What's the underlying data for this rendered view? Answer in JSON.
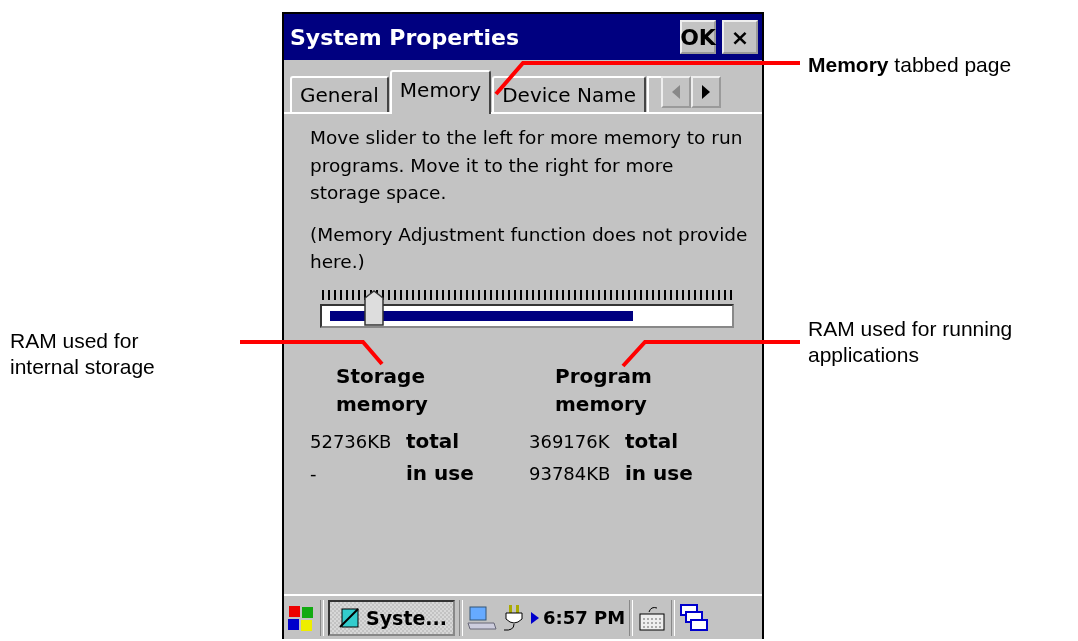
{
  "window": {
    "title": "System Properties",
    "buttons": [
      "OK",
      "×"
    ]
  },
  "tabs": [
    {
      "label": "General",
      "selected": false
    },
    {
      "label": "Memory",
      "selected": true
    },
    {
      "label": "Device Name",
      "selected": false
    }
  ],
  "paragraphs": [
    "Move slider to the left for more memory to run programs. Move it to the right for more storage space.",
    "(Memory Adjustment function does not provide here.)"
  ],
  "slider": {
    "level": 0.13
  },
  "memory_bar": {
    "level": 0.77
  },
  "columns": [
    {
      "heading": "Storage memory",
      "rows": [
        {
          "value": "52736KB",
          "label": "total"
        },
        {
          "value": "-",
          "label": "in use"
        }
      ]
    },
    {
      "heading": "Program memory",
      "rows": [
        {
          "value": "369176K",
          "label": "total"
        },
        {
          "value": "93784KB",
          "label": "in use"
        }
      ]
    }
  ],
  "taskbar": {
    "task": "Syste...",
    "time": "6:57 PM"
  },
  "annotations": [
    "**Memory** tabbed page",
    "RAM used for internal storage",
    "RAM used for running applications"
  ]
}
